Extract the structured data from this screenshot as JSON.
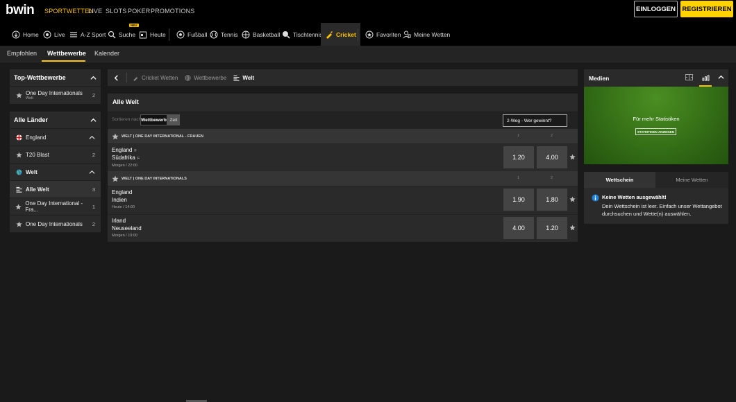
{
  "header": {
    "logo": "bwin",
    "nav": [
      "SPORTWETTEN",
      "LIVE",
      "SLOTS",
      "POKER",
      "PROMOTIONS"
    ],
    "login": "EINLOGGEN",
    "register": "REGISTRIEREN"
  },
  "sportbar": {
    "items": [
      "Home",
      "Live",
      "A-Z Sport",
      "Suche",
      "Heute",
      "Fußball",
      "Tennis",
      "Basketball",
      "Tischtennis",
      "Cricket",
      "Favoriten",
      "Meine Wetten"
    ],
    "new_badge": "NEU"
  },
  "subtabs": [
    "Empfohlen",
    "Wettbewerbe",
    "Kalender"
  ],
  "sidebar": {
    "top_title": "Top-Wettbewerbe",
    "top_items": [
      {
        "label": "One Day Internationals",
        "sub": "Welt",
        "count": "2"
      }
    ],
    "countries_title": "Alle Länder",
    "countries": [
      {
        "label": "England",
        "count": ""
      },
      {
        "label": "T20 Blast",
        "count": "2"
      },
      {
        "label": "Welt",
        "count": ""
      },
      {
        "label": "Alle Welt",
        "count": "3"
      },
      {
        "label": "One Day International - Fra...",
        "count": "1"
      },
      {
        "label": "One Day Internationals",
        "count": "2"
      }
    ]
  },
  "breadcrumb": [
    "Cricket Wetten",
    "Wettbewerbe",
    "Welt"
  ],
  "center": {
    "title": "Alle Welt",
    "sort_label": "Sortieren nach",
    "sort_options": [
      "Wettbewerb",
      "Zeit"
    ],
    "market": "2-Weg - Wer gewinnt?",
    "col1": "1",
    "col2": "2",
    "leagues": [
      {
        "name": "WELT | ONE DAY INTERNATIONAL - FRAUEN",
        "events": [
          {
            "team1": "England",
            "team2": "Südafrika",
            "flag": "F",
            "time": "Morgen / 22:00",
            "odd1": "1.20",
            "odd2": "4.00"
          }
        ]
      },
      {
        "name": "WELT | ONE DAY INTERNATIONALS",
        "events": [
          {
            "team1": "England",
            "team2": "Indien",
            "flag": "",
            "time": "Heute / 14:00",
            "odd1": "1.90",
            "odd2": "1.80"
          },
          {
            "team1": "Irland",
            "team2": "Neuseeland",
            "flag": "",
            "time": "Morgen / 19:00",
            "odd1": "4.00",
            "odd2": "1.20"
          }
        ]
      }
    ]
  },
  "right": {
    "medien_title": "Medien",
    "stats_text": "Für mehr Statistiken",
    "stats_button": "STATISTIKEN ANZEIGEN",
    "tabs": [
      "Wettschein",
      "Meine Wetten"
    ],
    "empty_title": "Keine Wetten ausgewählt!",
    "empty_text": "Dein Wettschein ist leer. Einfach unser Wettangebot durchsuchen und Wette(n) auswählen."
  },
  "colors": {
    "accent": "#ffc500",
    "register": "#ffd200",
    "bg": "#1a1a1a",
    "panel": "#2a2a2a",
    "info": "#1f7fd6"
  }
}
